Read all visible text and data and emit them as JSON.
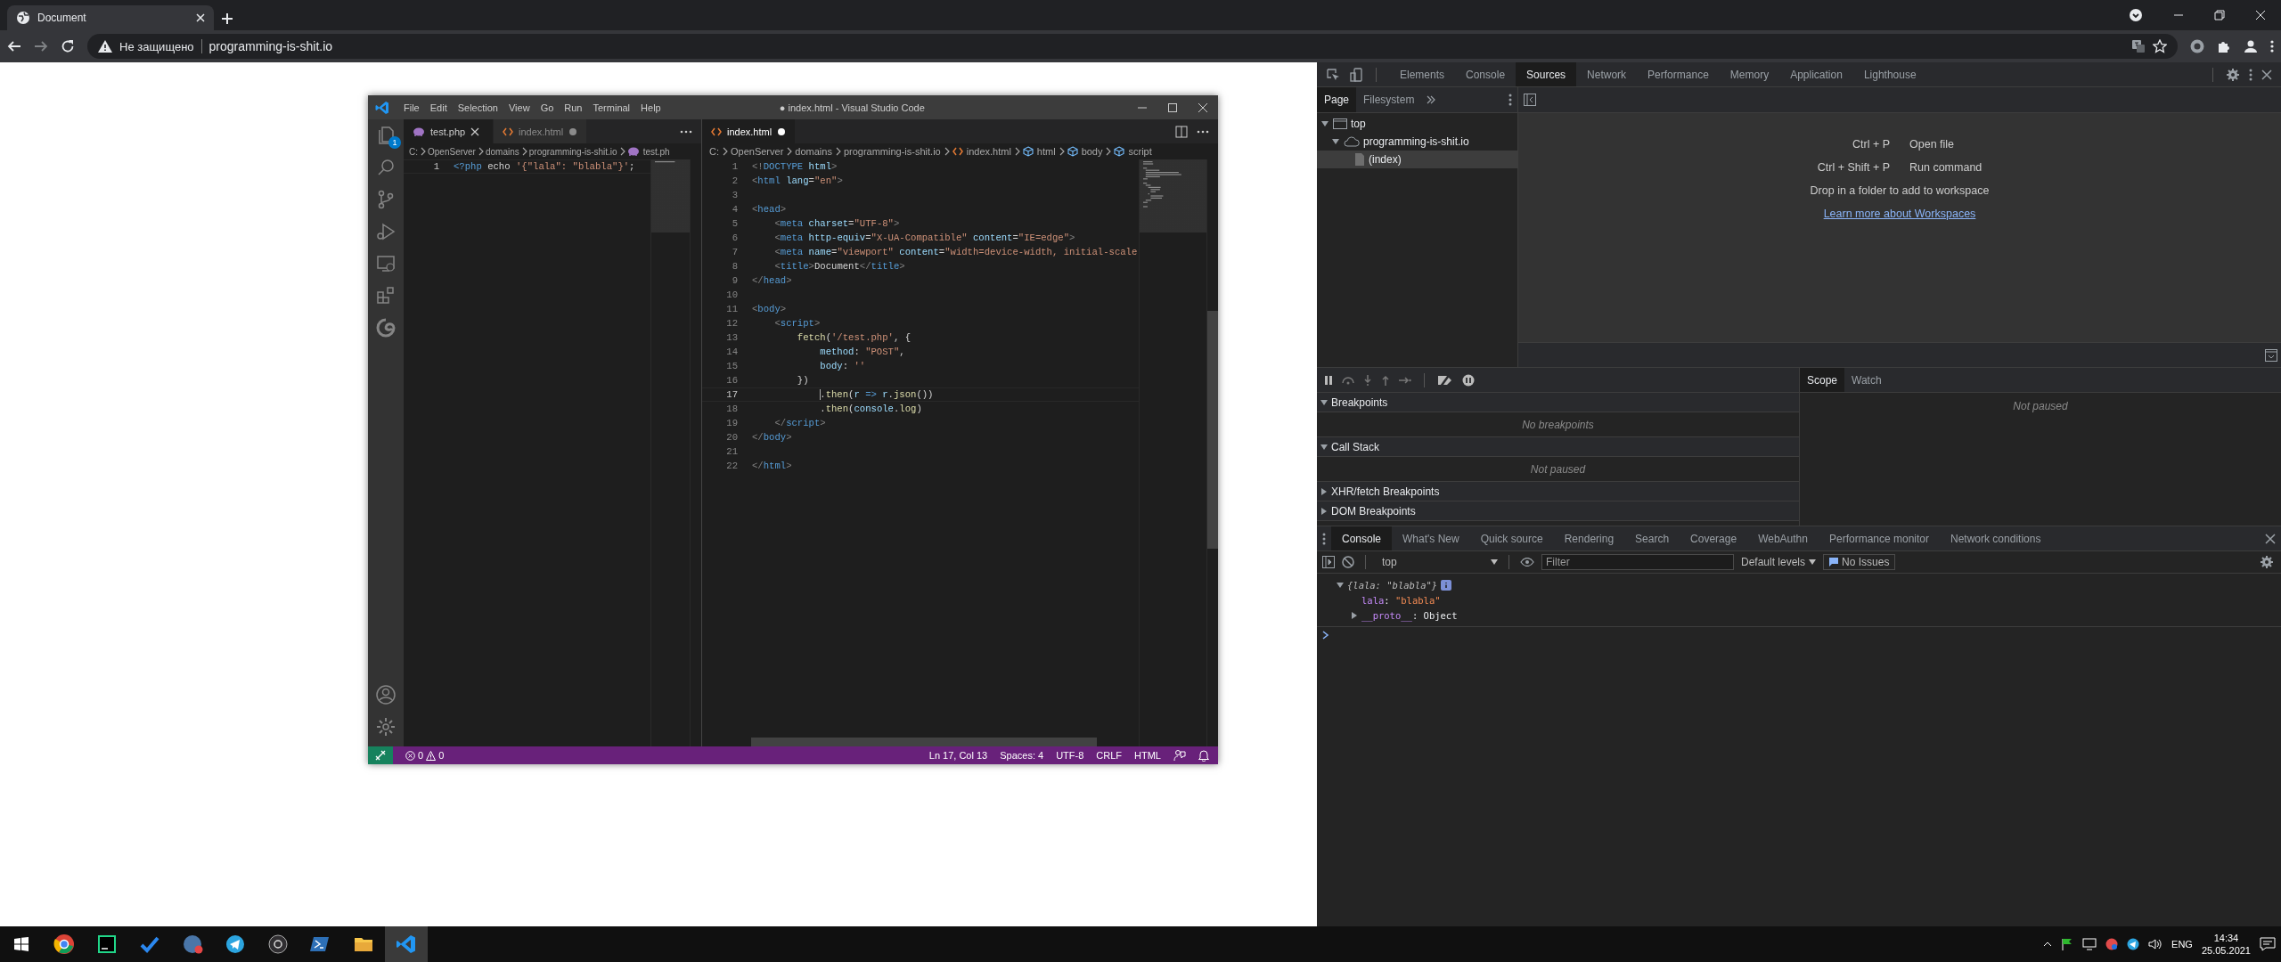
{
  "browser": {
    "tabs": [
      {
        "title": "Document",
        "selected": true
      }
    ],
    "address": {
      "security": "Не защищено",
      "url": "programming-is-shit.io"
    }
  },
  "editor_window": {
    "title": "● index.html - Visual Studio Code",
    "menu": [
      "File",
      "Edit",
      "Selection",
      "View",
      "Go",
      "Run",
      "Terminal",
      "Help"
    ],
    "explorer_badge": "1",
    "groups": [
      {
        "tabs": [
          {
            "label": "test.php",
            "kind": "php",
            "selected": true,
            "modified": false
          },
          {
            "label": "index.html",
            "kind": "html",
            "selected": false,
            "modified": true
          }
        ],
        "breadcrumb": [
          {
            "label": "C:",
            "kind": "folder"
          },
          {
            "label": "OpenServer",
            "kind": "folder"
          },
          {
            "label": "domains",
            "kind": "folder"
          },
          {
            "label": "programming-is-shit.io",
            "kind": "folder"
          },
          {
            "label": "test.ph",
            "kind": "php"
          }
        ],
        "lines": [
          {
            "number": "1",
            "current": true,
            "cursor": false,
            "tokens": [
              {
                "kind": "keyword",
                "text": "<?php"
              },
              {
                "kind": "text",
                "text": " echo "
              },
              {
                "kind": "string",
                "text": "'{\"lala\": \"blabla\"}'"
              },
              {
                "kind": "text",
                "text": ";"
              }
            ]
          }
        ]
      },
      {
        "tabs": [
          {
            "label": "index.html",
            "kind": "html",
            "selected": true,
            "modified": true
          }
        ],
        "breadcrumb": [
          {
            "label": "C:",
            "kind": "folder"
          },
          {
            "label": "OpenServer",
            "kind": "folder"
          },
          {
            "label": "domains",
            "kind": "folder"
          },
          {
            "label": "programming-is-shit.io",
            "kind": "folder"
          },
          {
            "label": "index.html",
            "kind": "html"
          },
          {
            "label": "html",
            "kind": "symbol"
          },
          {
            "label": "body",
            "kind": "symbol"
          },
          {
            "label": "script",
            "kind": "symbol"
          }
        ],
        "lines": [
          {
            "number": "1",
            "current": false,
            "cursor": false,
            "tokens": [
              {
                "kind": "punct",
                "text": "<!"
              },
              {
                "kind": "tag",
                "text": "DOCTYPE"
              },
              {
                "kind": "attr",
                "text": " html"
              },
              {
                "kind": "punct",
                "text": ">"
              }
            ]
          },
          {
            "number": "2",
            "current": false,
            "cursor": false,
            "tokens": [
              {
                "kind": "punct",
                "text": "<"
              },
              {
                "kind": "tag",
                "text": "html"
              },
              {
                "kind": "attr",
                "text": " lang"
              },
              {
                "kind": "text",
                "text": "="
              },
              {
                "kind": "string",
                "text": "\"en\""
              },
              {
                "kind": "punct",
                "text": ">"
              }
            ]
          },
          {
            "number": "3",
            "current": false
          },
          {
            "number": "4",
            "current": false,
            "cursor": false,
            "tokens": [
              {
                "kind": "punct",
                "text": "<"
              },
              {
                "kind": "tag",
                "text": "head"
              },
              {
                "kind": "punct",
                "text": ">"
              }
            ]
          },
          {
            "number": "5",
            "current": false,
            "cursor": false,
            "tokens": [
              {
                "kind": "punct",
                "text": "    <"
              },
              {
                "kind": "tag",
                "text": "meta"
              },
              {
                "kind": "attr",
                "text": " charset"
              },
              {
                "kind": "text",
                "text": "="
              },
              {
                "kind": "string",
                "text": "\"UTF-8\""
              },
              {
                "kind": "punct",
                "text": ">"
              }
            ]
          },
          {
            "number": "6",
            "current": false,
            "cursor": false,
            "tokens": [
              {
                "kind": "punct",
                "text": "    <"
              },
              {
                "kind": "tag",
                "text": "meta"
              },
              {
                "kind": "attr",
                "text": " http-equiv"
              },
              {
                "kind": "text",
                "text": "="
              },
              {
                "kind": "string",
                "text": "\"X-UA-Compatible\""
              },
              {
                "kind": "attr",
                "text": " content"
              },
              {
                "kind": "text",
                "text": "="
              },
              {
                "kind": "string",
                "text": "\"IE=edge\""
              },
              {
                "kind": "punct",
                "text": ">"
              }
            ]
          },
          {
            "number": "7",
            "current": false,
            "cursor": false,
            "tokens": [
              {
                "kind": "punct",
                "text": "    <"
              },
              {
                "kind": "tag",
                "text": "meta"
              },
              {
                "kind": "attr",
                "text": " name"
              },
              {
                "kind": "text",
                "text": "="
              },
              {
                "kind": "string",
                "text": "\"viewport\""
              },
              {
                "kind": "attr",
                "text": " content"
              },
              {
                "kind": "text",
                "text": "="
              },
              {
                "kind": "string",
                "text": "\"width=device-width, initial-scale"
              }
            ]
          },
          {
            "number": "8",
            "current": false,
            "cursor": false,
            "tokens": [
              {
                "kind": "punct",
                "text": "    <"
              },
              {
                "kind": "tag",
                "text": "title"
              },
              {
                "kind": "punct",
                "text": ">"
              },
              {
                "kind": "text",
                "text": "Document"
              },
              {
                "kind": "punct",
                "text": "</"
              },
              {
                "kind": "tag",
                "text": "title"
              },
              {
                "kind": "punct",
                "text": ">"
              }
            ]
          },
          {
            "number": "9",
            "current": false,
            "cursor": false,
            "tokens": [
              {
                "kind": "punct",
                "text": "</"
              },
              {
                "kind": "tag",
                "text": "head"
              },
              {
                "kind": "punct",
                "text": ">"
              }
            ]
          },
          {
            "number": "10",
            "current": false
          },
          {
            "number": "11",
            "current": false,
            "cursor": false,
            "tokens": [
              {
                "kind": "punct",
                "text": "<"
              },
              {
                "kind": "tag",
                "text": "body"
              },
              {
                "kind": "punct",
                "text": ">"
              }
            ]
          },
          {
            "number": "12",
            "current": false,
            "cursor": false,
            "tokens": [
              {
                "kind": "punct",
                "text": "    <"
              },
              {
                "kind": "tag",
                "text": "script"
              },
              {
                "kind": "punct",
                "text": ">"
              }
            ]
          },
          {
            "number": "13",
            "current": false,
            "cursor": false,
            "tokens": [
              {
                "kind": "func",
                "text": "        fetch"
              },
              {
                "kind": "text",
                "text": "("
              },
              {
                "kind": "string",
                "text": "'/test.php'"
              },
              {
                "kind": "text",
                "text": ", {"
              }
            ]
          },
          {
            "number": "14",
            "current": false,
            "cursor": false,
            "tokens": [
              {
                "kind": "var",
                "text": "            method"
              },
              {
                "kind": "text",
                "text": ": "
              },
              {
                "kind": "string",
                "text": "\"POST\""
              },
              {
                "kind": "text",
                "text": ","
              }
            ]
          },
          {
            "number": "15",
            "current": false,
            "cursor": false,
            "tokens": [
              {
                "kind": "var",
                "text": "            body"
              },
              {
                "kind": "text",
                "text": ": "
              },
              {
                "kind": "string",
                "text": "''"
              }
            ]
          },
          {
            "number": "16",
            "current": false,
            "cursor": false,
            "tokens": [
              {
                "kind": "text",
                "text": "        })"
              }
            ]
          },
          {
            "number": "17",
            "current": true,
            "cursor": true,
            "tokens": [
              {
                "kind": "text",
                "text": "            ."
              },
              {
                "kind": "func",
                "text": "then"
              },
              {
                "kind": "text",
                "text": "("
              },
              {
                "kind": "var",
                "text": "r"
              },
              {
                "kind": "keyword",
                "text": " => "
              },
              {
                "kind": "var",
                "text": "r"
              },
              {
                "kind": "text",
                "text": "."
              },
              {
                "kind": "func",
                "text": "json"
              },
              {
                "kind": "text",
                "text": "())"
              }
            ]
          },
          {
            "number": "18",
            "current": false,
            "cursor": false,
            "tokens": [
              {
                "kind": "text",
                "text": "            ."
              },
              {
                "kind": "func",
                "text": "then"
              },
              {
                "kind": "text",
                "text": "("
              },
              {
                "kind": "var",
                "text": "console"
              },
              {
                "kind": "text",
                "text": "."
              },
              {
                "kind": "func",
                "text": "log"
              },
              {
                "kind": "text",
                "text": ")"
              }
            ]
          },
          {
            "number": "19",
            "current": false,
            "cursor": false,
            "tokens": [
              {
                "kind": "punct",
                "text": "    </"
              },
              {
                "kind": "tag",
                "text": "script"
              },
              {
                "kind": "punct",
                "text": ">"
              }
            ]
          },
          {
            "number": "20",
            "current": false,
            "cursor": false,
            "tokens": [
              {
                "kind": "punct",
                "text": "</"
              },
              {
                "kind": "tag",
                "text": "body"
              },
              {
                "kind": "punct",
                "text": ">"
              }
            ]
          },
          {
            "number": "21",
            "current": false
          },
          {
            "number": "22",
            "current": false,
            "cursor": false,
            "tokens": [
              {
                "kind": "punct",
                "text": "</"
              },
              {
                "kind": "tag",
                "text": "html"
              },
              {
                "kind": "punct",
                "text": ">"
              }
            ]
          }
        ]
      }
    ],
    "status_bar": {
      "errors": "0",
      "warnings": "0",
      "items": [
        "Ln 17, Col 13",
        "Spaces: 4",
        "UTF-8",
        "CRLF",
        "HTML"
      ]
    }
  },
  "devtools": {
    "tabs": [
      {
        "label": "Elements",
        "selected": false
      },
      {
        "label": "Console",
        "selected": false
      },
      {
        "label": "Sources",
        "selected": true
      },
      {
        "label": "Network",
        "selected": false
      },
      {
        "label": "Performance",
        "selected": false
      },
      {
        "label": "Memory",
        "selected": false
      },
      {
        "label": "Application",
        "selected": false
      },
      {
        "label": "Lighthouse",
        "selected": false
      }
    ],
    "navigator": {
      "tabs": [
        {
          "label": "Page",
          "selected": true
        },
        {
          "label": "Filesystem",
          "selected": false
        }
      ],
      "tree": [
        {
          "label": "top",
          "kind": "frame",
          "expanded": true,
          "selected": false,
          "children": [
            {
              "label": "programming-is-shit.io",
              "kind": "domain",
              "expanded": true,
              "selected": false,
              "children": [
                {
                  "label": "(index)",
                  "kind": "file",
                  "selected": true
                }
              ]
            }
          ]
        }
      ]
    },
    "editor_placeholder": {
      "shortcuts": [
        {
          "keys": "Ctrl + P",
          "action": "Open file"
        },
        {
          "keys": "Ctrl + Shift + P",
          "action": "Run command"
        }
      ],
      "hint": "Drop in a folder to add to workspace",
      "link": "Learn more about Workspaces"
    },
    "debugger_panes": [
      {
        "title": "Breakpoints",
        "expanded": true,
        "message": "No breakpoints"
      },
      {
        "title": "Call Stack",
        "expanded": true,
        "message": "Not paused"
      },
      {
        "title": "XHR/fetch Breakpoints",
        "expanded": false
      },
      {
        "title": "DOM Breakpoints",
        "expanded": false
      }
    ],
    "sidebar_tabs": [
      {
        "label": "Scope",
        "selected": true
      },
      {
        "label": "Watch",
        "selected": false
      }
    ],
    "scope_message": "Not paused",
    "drawer_tabs": [
      {
        "label": "Console",
        "selected": true
      },
      {
        "label": "What's New",
        "selected": false
      },
      {
        "label": "Quick source",
        "selected": false
      },
      {
        "label": "Rendering",
        "selected": false
      },
      {
        "label": "Search",
        "selected": false
      },
      {
        "label": "Coverage",
        "selected": false
      },
      {
        "label": "WebAuthn",
        "selected": false
      },
      {
        "label": "Performance monitor",
        "selected": false
      },
      {
        "label": "Network conditions",
        "selected": false
      }
    ],
    "console_toolbar": {
      "context": "top",
      "filter_placeholder": "Filter",
      "levels": "Default levels",
      "issues": "No Issues"
    },
    "console_messages": [
      {
        "expanded": true,
        "preview": "{lala: \"blabla\"}",
        "properties": [
          {
            "name": "lala",
            "separator": ": ",
            "value": "\"blabla\"",
            "kind": "string",
            "expandable": false
          },
          {
            "name": "__proto__",
            "separator": ": ",
            "value": "Object",
            "kind": "object",
            "expandable": true
          }
        ]
      }
    ]
  },
  "taskbar": {
    "apps": [
      {
        "kind": "browser",
        "selected": false
      },
      {
        "kind": "ide",
        "selected": false
      },
      {
        "kind": "todo",
        "selected": false
      },
      {
        "kind": "social",
        "selected": false
      },
      {
        "kind": "messenger",
        "selected": false
      },
      {
        "kind": "recorder",
        "selected": false
      },
      {
        "kind": "shell",
        "selected": false
      },
      {
        "kind": "files",
        "selected": false
      },
      {
        "kind": "code",
        "selected": true
      }
    ],
    "language": "ENG",
    "time": "14:34",
    "date": "25.05.2021"
  }
}
